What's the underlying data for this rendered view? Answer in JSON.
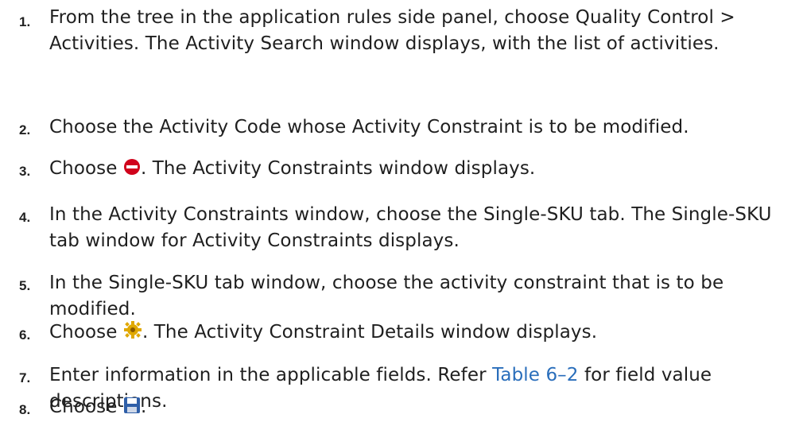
{
  "steps": [
    {
      "number": "1.",
      "text": "From the tree in the application rules side panel, choose Quality Control > Activities. The Activity Search window displays, with the list of activities."
    },
    {
      "number": "2.",
      "text": "Choose the Activity Code whose Activity Constraint is to be modified."
    },
    {
      "number": "3.",
      "before": "Choose",
      "icon": "remove-icon",
      "after": ". The Activity Constraints window displays."
    },
    {
      "number": "4.",
      "text": "In the Activity Constraints window, choose the Single-SKU tab. The Single-SKU tab window for Activity Constraints displays."
    },
    {
      "number": "5.",
      "text": "In the Single-SKU tab window, choose the activity constraint that is to be modified."
    },
    {
      "number": "6.",
      "before": "Choose",
      "icon": "gear-icon",
      "after": ". The Activity Constraint Details window displays."
    },
    {
      "number": "7.",
      "before": "Enter information in the applicable fields. Refer",
      "link": "Table 6–2",
      "after": "for field value descriptions."
    },
    {
      "number": "8.",
      "before": "Choose",
      "icon": "save-icon",
      "after": "."
    }
  ],
  "colors": {
    "link": "#2a6ebb",
    "remove_icon": "#d0021b",
    "gear_icon": "#e0a800",
    "save_icon": "#2f5fa8"
  }
}
